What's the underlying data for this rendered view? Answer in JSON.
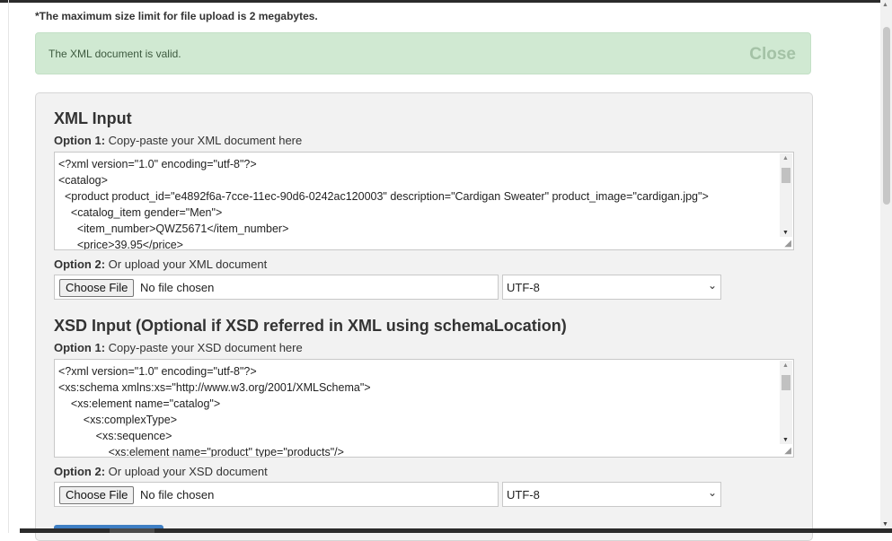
{
  "notice": "*The maximum size limit for file upload is 2 megabytes.",
  "alert": {
    "message": "The XML document is valid.",
    "close_label": "Close"
  },
  "xml": {
    "heading": "XML Input",
    "option1_bold": "Option 1:",
    "option1_text": " Copy-paste your XML document here",
    "lines": [
      "<?xml version=\"1.0\" encoding=\"utf-8\"?>",
      "<catalog>",
      "  <product product_id=\"e4892f6a-7cce-11ec-90d6-0242ac120003\" description=\"Cardigan Sweater\" product_image=\"cardigan.jpg\">",
      "    <catalog_item gender=\"Men\">",
      "      <item_number>QWZ5671</item_number>",
      "      <price>39.95</price>"
    ],
    "option2_bold": "Option 2:",
    "option2_text": " Or upload your XML document",
    "file_button": "Choose File",
    "file_status": "No file chosen",
    "encoding": "UTF-8"
  },
  "xsd": {
    "heading": "XSD Input (Optional if XSD referred in XML using schemaLocation)",
    "option1_bold": "Option 1:",
    "option1_text": " Copy-paste your XSD document here",
    "lines": [
      "<?xml version=\"1.0\" encoding=\"utf-8\"?>",
      "<xs:schema xmlns:xs=\"http://www.w3.org/2001/XMLSchema\">",
      "    <xs:element name=\"catalog\">",
      "        <xs:complexType>",
      "            <xs:sequence>",
      "                <xs:element name=\"product\" type=\"products\"/>"
    ],
    "option2_bold": "Option 2:",
    "option2_text": " Or upload your XSD document",
    "file_button": "Choose File",
    "file_status": "No file chosen",
    "encoding": "UTF-8"
  },
  "icons": {
    "scroll_up": "scroll-up-arrow-icon",
    "scroll_down": "scroll-down-arrow-icon",
    "dropdown": "chevron-down-icon",
    "resize": "resize-grip-icon"
  },
  "colors": {
    "alert_bg": "#d0e9d2",
    "panel_bg": "#f2f2f2",
    "submit_accent": "#3f7fc4"
  }
}
